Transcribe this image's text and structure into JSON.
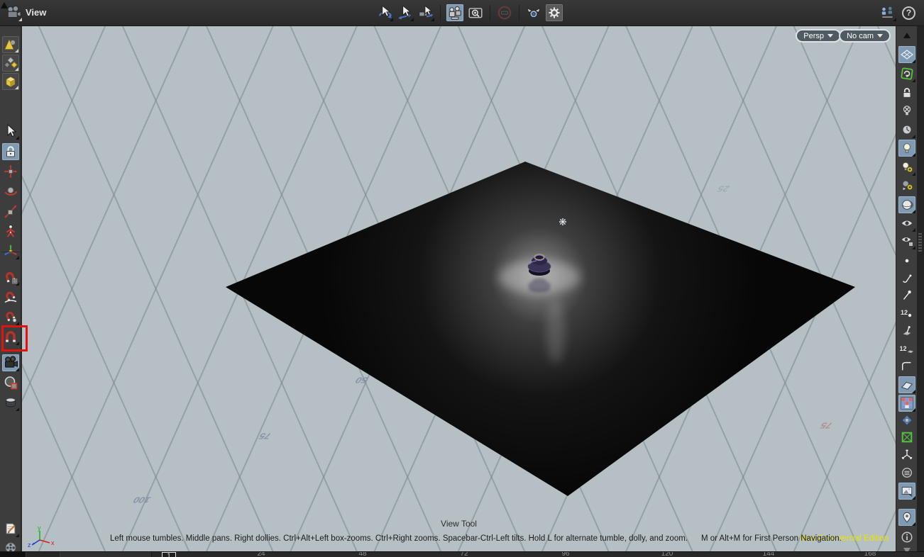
{
  "app": {
    "title": "View"
  },
  "top_toolbar": {
    "title": "View",
    "help_glyph": "?",
    "center_icons": [
      "tumble-tool",
      "pan-tool",
      "dolly-tool",
      "frame-view",
      "box-zoom",
      "view-mask-disabled",
      "stereo-camera",
      "viewport-options-gear"
    ],
    "right_icons": [
      "desktop-layout",
      "help"
    ]
  },
  "left_toolbar": {
    "items": [
      "display-objects",
      "display-components",
      "display-geometry",
      "select-tool",
      "secure-selection-lock",
      "translate-tool",
      "rotate-tool",
      "scale-tool",
      "pose-tool",
      "handle-alignment",
      "snap-grid",
      "snap-curve",
      "snap-point",
      "snap-multi",
      "view-tool",
      "render-region-tool",
      "template-tool",
      "takes-list",
      "flipbook-render"
    ],
    "active_item": "view-tool"
  },
  "right_toolbar": {
    "items": [
      "scroll-up",
      "reference-plane",
      "auto-update",
      "object-lock",
      "disable-lighting",
      "normal-lighting",
      "headlight-only",
      "add-light",
      "add-camera",
      "smooth-shaded",
      "display-options-eye",
      "show-geometry-eye",
      "display-points",
      "display-point-normals",
      "display-point-trails",
      "display-point-numbers",
      "display-prim-normals",
      "display-prim-numbers",
      "display-profiles",
      "display-shaded-prims",
      "display-textures",
      "display-materials",
      "display-constraints",
      "display-fan",
      "display-multipass",
      "display-background-image",
      "display-handles-pin",
      "viewport-info",
      "scroll-down"
    ],
    "point_number_label": "12",
    "prim_number_label": "12",
    "info_glyph": "i"
  },
  "viewport": {
    "camera_projection": "Persp",
    "camera_binding": "No cam",
    "tool_title": "View Tool",
    "help_line_1": "Left mouse tumbles. Middle pans. Right dollies. Ctrl+Alt+Left box-zooms. Ctrl+Right zooms. Spacebar-Ctrl-Left tilts. Hold L for alternate tumble, dolly, and zoom.",
    "help_line_2": "M or Alt+M for First Person Navigation.",
    "watermark": "Non-Commercial Edition",
    "axis": {
      "x": "x",
      "y": "y",
      "z": "z"
    },
    "grid_labels": [
      "25",
      "50",
      "75",
      "100",
      "75"
    ]
  },
  "timeline": {
    "current_frame": "1",
    "ticks": [
      "24",
      "48",
      "72",
      "96",
      "120",
      "144",
      "168"
    ]
  },
  "colors": {
    "selection_highlight": "#7f9ab3",
    "annotation_box": "#e01212",
    "watermark_text": "#e8e400",
    "viewport_background": "#b6c0c4",
    "ground_plane": "#0a0a0a"
  }
}
